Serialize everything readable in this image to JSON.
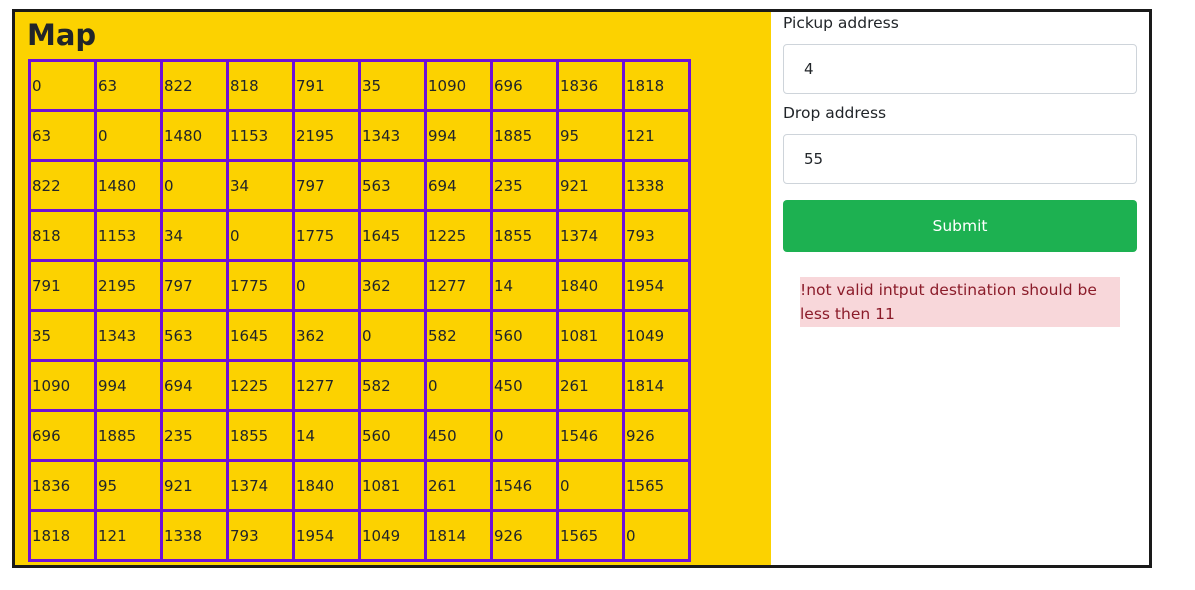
{
  "map": {
    "title": "Map",
    "matrix": [
      [
        "0",
        "63",
        "822",
        "818",
        "791",
        "35",
        "1090",
        "696",
        "1836",
        "1818"
      ],
      [
        "63",
        "0",
        "1480",
        "1153",
        "2195",
        "1343",
        "994",
        "1885",
        "95",
        "121"
      ],
      [
        "822",
        "1480",
        "0",
        "34",
        "797",
        "563",
        "694",
        "235",
        "921",
        "1338"
      ],
      [
        "818",
        "1153",
        "34",
        "0",
        "1775",
        "1645",
        "1225",
        "1855",
        "1374",
        "793"
      ],
      [
        "791",
        "2195",
        "797",
        "1775",
        "0",
        "362",
        "1277",
        "14",
        "1840",
        "1954"
      ],
      [
        "35",
        "1343",
        "563",
        "1645",
        "362",
        "0",
        "582",
        "560",
        "1081",
        "1049"
      ],
      [
        "1090",
        "994",
        "694",
        "1225",
        "1277",
        "582",
        "0",
        "450",
        "261",
        "1814"
      ],
      [
        "696",
        "1885",
        "235",
        "1855",
        "14",
        "560",
        "450",
        "0",
        "1546",
        "926"
      ],
      [
        "1836",
        "95",
        "921",
        "1374",
        "1840",
        "1081",
        "261",
        "1546",
        "0",
        "1565"
      ],
      [
        "1818",
        "121",
        "1338",
        "793",
        "1954",
        "1049",
        "1814",
        "926",
        "1565",
        "0"
      ]
    ]
  },
  "form": {
    "pickup_label": "Pickup address",
    "pickup_value": "4",
    "drop_label": "Drop address",
    "drop_value": "55",
    "submit_label": "Submit",
    "error_message": "!not valid intput destination should be less then 11"
  },
  "colors": {
    "map_background": "#fcd200",
    "grid_border": "#6f10d8",
    "submit_button": "#1db151",
    "alert_background": "#f8d7da",
    "alert_text": "#8b1c2a"
  }
}
